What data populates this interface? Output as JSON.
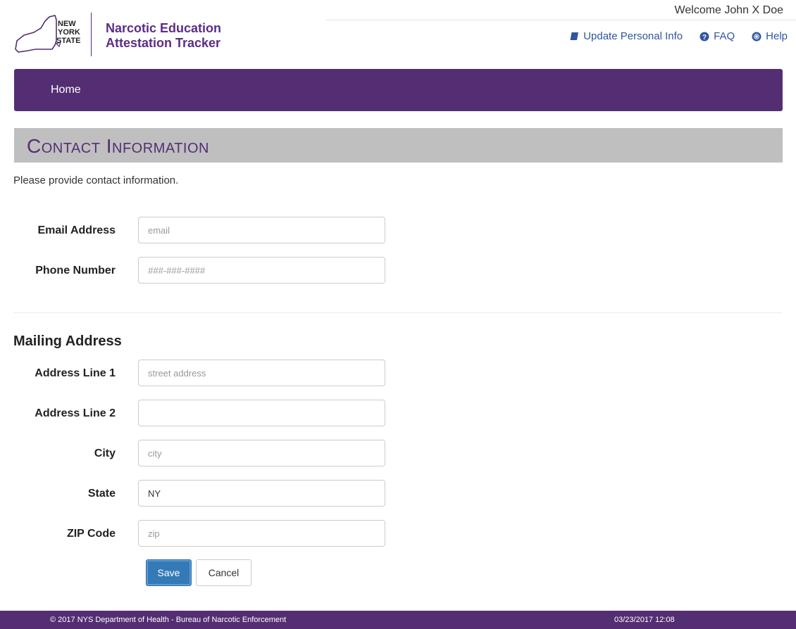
{
  "header": {
    "logo_lines": [
      "NEW",
      "YORK",
      "STATE"
    ],
    "app_title_line1": "Narcotic Education",
    "app_title_line2": "Attestation Tracker",
    "welcome": "Welcome John X Doe",
    "links": [
      {
        "label": "Update Personal Info",
        "icon": "book-icon"
      },
      {
        "label": "FAQ",
        "icon": "question-circle-icon"
      },
      {
        "label": "Help",
        "icon": "life-ring-icon"
      }
    ]
  },
  "nav": {
    "home": "Home"
  },
  "section": {
    "title": "Contact Information",
    "intro": "Please provide contact information."
  },
  "contact": {
    "email_label": "Email Address",
    "email_placeholder": "email",
    "email_value": "",
    "phone_label": "Phone Number",
    "phone_placeholder": "###-###-####",
    "phone_value": ""
  },
  "mailing": {
    "heading": "Mailing Address",
    "address1_label": "Address Line 1",
    "address1_placeholder": "street address",
    "address2_label": "Address Line 2",
    "address2_placeholder": "",
    "city_label": "City",
    "city_placeholder": "city",
    "state_label": "State",
    "state_value": "NY",
    "zip_label": "ZIP Code",
    "zip_placeholder": "zip"
  },
  "actions": {
    "save": "Save",
    "cancel": "Cancel"
  },
  "footer": {
    "copyright": "© 2017 NYS Department of Health - Bureau of Narcotic Enforcement",
    "timestamp": "03/23/2017 12:08"
  },
  "colors": {
    "brand_purple": "#542e73",
    "link_blue": "#31559e",
    "primary_button": "#337ab7",
    "section_bar": "#bfbfbf"
  }
}
